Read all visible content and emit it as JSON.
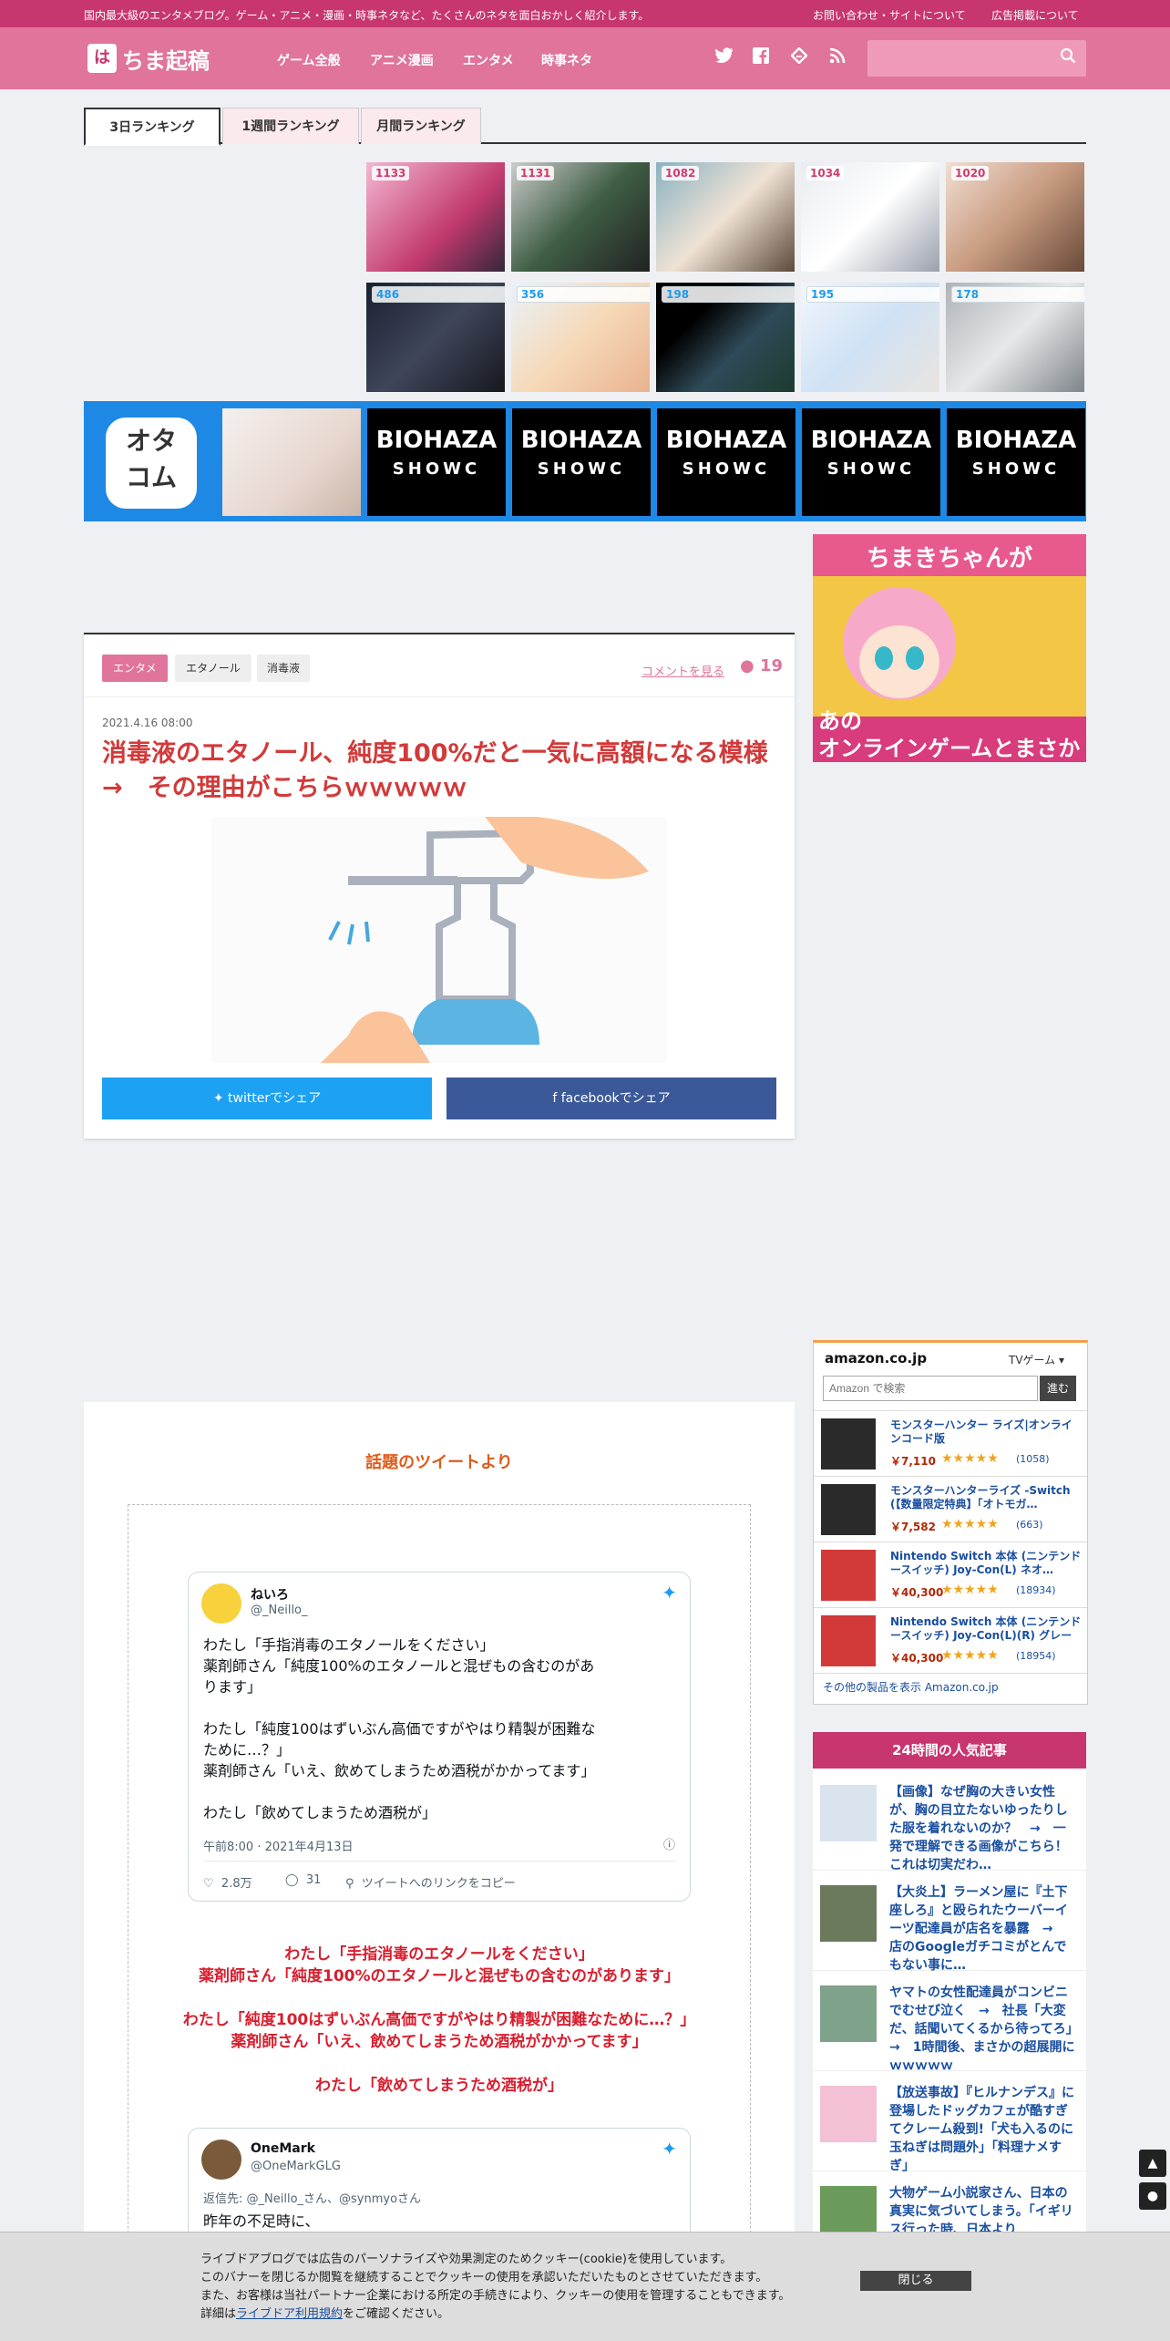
{
  "topbar": {
    "tagline": "国内最大級のエンタメブログ。ゲーム・アニメ・漫画・時事ネタなど、たくさんのネタを面白おかしく紹介します。",
    "contact": "お問い合わせ・サイトについて",
    "ads": "広告掲載について"
  },
  "header": {
    "logo_mark": "は",
    "logo_text": "ちま起稿",
    "nav": [
      "ゲーム全般",
      "アニメ漫画",
      "エンタメ",
      "時事ネタ"
    ],
    "search_placeholder": ""
  },
  "ranking": {
    "tabs": [
      "3日ランキング",
      "1週間ランキング",
      "月間ランキング"
    ],
    "row1": [
      "1133",
      "1131",
      "1082",
      "1034",
      "1020"
    ],
    "row2": [
      "486",
      "356",
      "198",
      "195",
      "178"
    ]
  },
  "banner": {
    "logo": "オタコム",
    "thumb_title": "BIOHAZA",
    "thumb_sub": "SHOWC"
  },
  "side_ad": {
    "title": "ちまきちゃんが",
    "body": "あの\nオンラインゲームとまさか"
  },
  "article": {
    "tags": [
      "エンタメ",
      "エタノール",
      "消毒液"
    ],
    "comment_link": "コメントを見る",
    "comment_count": "19",
    "date": "2021.4.16 08:00",
    "title": "消毒液のエタノール、純度100%だと一気に高額になる模様　→　その理由がこちらｗｗｗｗｗ",
    "share_twitter": "twitterでシェア",
    "share_facebook": "facebookでシェア"
  },
  "tweets": {
    "heading": "話題のツイートより",
    "t1": {
      "name": "ねいろ",
      "handle": "@_Neillo_",
      "lines": [
        "わたし「手指消毒のエタノールをください」",
        "薬剤師さん「純度100%のエタノールと混ぜもの含むのがあ",
        "ります」",
        "",
        "わたし「純度100はずいぶん高価ですがやはり精製が困難な",
        "ために…？」",
        "薬剤師さん「いえ、飲めてしまうため酒税がかかってます」",
        "",
        "わたし「飲めてしまうため酒税が」"
      ],
      "time": "午前8:00 · 2021年4月13日",
      "likes": "2.8万",
      "replies": "31",
      "copy": "ツイートへのリンクをコピー"
    },
    "quote": [
      "わたし「手指消毒のエタノールをください」",
      "薬剤師さん「純度100%のエタノールと混ぜもの含むのがあります」",
      "",
      "わたし「純度100はずいぶん高価ですがやはり精製が困難なために…？」",
      "薬剤師さん「いえ、飲めてしまうため酒税がかかってます」",
      "",
      "わたし「飲めてしまうため酒税が」"
    ],
    "t2": {
      "name": "OneMark",
      "handle": "@OneMarkGLG",
      "reply_to": "返信先: @_Neillo_さん、@synmyoさん",
      "text": "昨年の不足時に、"
    }
  },
  "amazon": {
    "logo": "amazon.co.jp",
    "category": "TVゲーム",
    "search_placeholder": "Amazon で検索",
    "go": "進む",
    "items": [
      {
        "name": "モンスターハンター ライズ|オンラインコード版",
        "price": "￥7,110",
        "rating": "★★★★★",
        "reviews": "(1058)"
      },
      {
        "name": "モンスターハンターライズ -Switch (【数量限定特典】「オトモガ…",
        "price": "￥7,582",
        "rating": "★★★★★",
        "reviews": "(663)"
      },
      {
        "name": "Nintendo Switch 本体 (ニンテンドースイッチ) Joy-Con(L) ネオ…",
        "price": "￥40,300",
        "rating": "★★★★★",
        "reviews": "(18934)"
      },
      {
        "name": "Nintendo Switch 本体 (ニンテンドースイッチ) Joy-Con(L)(R) グレー",
        "price": "￥40,300",
        "rating": "★★★★★",
        "reviews": "(18954)"
      }
    ],
    "more": "その他の製品を表示 Amazon.co.jp"
  },
  "popular": {
    "heading": "24時間の人気記事",
    "items": [
      "【画像】なぜ胸の大きい女性が、胸の目立たないゆったりした服を着れないのか？　→　一発で理解できる画像がこちら！これは切実だわ…",
      "【大炎上】ラーメン屋に『土下座しろ』と殴られたウーバーイーツ配達員が店名を暴露　→　店のGoogleガチコミがとんでもない事に…",
      "ヤマトの女性配達員がコンビニでむせび泣く　→　社長「大変だ、話聞いてくるから待ってろ」　→　1時間後、まさかの超展開にｗｗｗｗｗ",
      "【放送事故】『ヒルナンデス』に登場したドッグカフェが酷すぎてクレーム殺到!「犬も入るのに玉ねぎは問題外」「料理ナメすぎ」",
      "大物ゲーム小説家さん、日本の真実に気づいてしまう。「イギリス行った時、日本より"
    ]
  },
  "cookie": {
    "lines": [
      "ライブドアブログでは広告のパーソナライズや効果測定のためクッキー(cookie)を使用しています。",
      "このバナーを閉じるか閲覧を継続することでクッキーの使用を承認いただいたものとさせていただきます。",
      "また、お客様は当社パートナー企業における所定の手続きにより、クッキーの使用を管理することもできます。"
    ],
    "line4_pre": "詳細は",
    "line4_link": "ライブドア利用規約",
    "line4_post": "をご確認ください。",
    "close": "閉じる"
  }
}
